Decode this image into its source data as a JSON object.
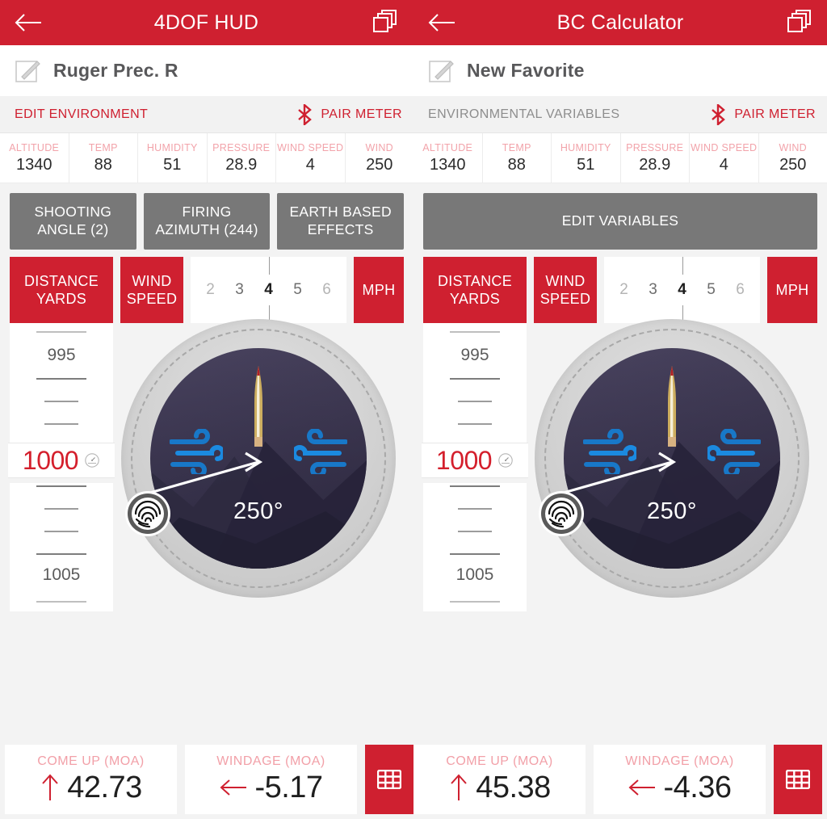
{
  "accent": {
    "red": "#cf2030",
    "gray_button": "#787878",
    "label_pink": "#f2a3aa"
  },
  "panels": [
    {
      "nav": {
        "title": "4DOF HUD",
        "back_icon": "arrow-left-icon",
        "copy_icon": "copy-windows-icon"
      },
      "profile": {
        "name": "Ruger Prec. R",
        "edit_icon": "pencil-square-icon"
      },
      "subbar": {
        "left_label": "EDIT ENVIRONMENT",
        "left_muted": false,
        "pair_label": "PAIR METER",
        "pair_icon": "bluetooth-icon"
      },
      "stats": [
        {
          "label": "ALTITUDE",
          "value": "1340"
        },
        {
          "label": "TEMP",
          "value": "88"
        },
        {
          "label": "HUMIDITY",
          "value": "51"
        },
        {
          "label": "PRESSURE",
          "value": "28.9"
        },
        {
          "label": "WIND SPEED",
          "value": "4"
        },
        {
          "label": "WIND",
          "value": "250"
        }
      ],
      "gray_buttons": [
        {
          "label": "SHOOTING ANGLE (2)"
        },
        {
          "label": "FIRING AZIMUTH (244)"
        },
        {
          "label": "EARTH BASED EFFECTS"
        }
      ],
      "selector": {
        "distance_label": "DISTANCE YARDS",
        "wind_label": "WIND SPEED",
        "unit_label": "MPH",
        "wind_options": [
          "2",
          "3",
          "4",
          "5",
          "6"
        ],
        "wind_selected": "4"
      },
      "distance_picker": {
        "above_label": "995",
        "selected": "1000",
        "below_label": "1005",
        "gauge_icon": "speedometer-icon"
      },
      "compass": {
        "degrees": "250°",
        "bullet_icon": "bullet-icon",
        "wind_icon": "wind-lines-icon",
        "handle_icon": "fingerprint-icon"
      },
      "results": [
        {
          "label": "COME UP (MOA)",
          "value": "42.73",
          "arrow": "arrow-up-icon"
        },
        {
          "label": "WINDAGE (MOA)",
          "value": "-5.17",
          "arrow": "arrow-left-icon"
        }
      ],
      "results_grid_icon": "table-grid-icon"
    },
    {
      "nav": {
        "title": "BC Calculator",
        "back_icon": "arrow-left-icon",
        "copy_icon": "copy-windows-icon"
      },
      "profile": {
        "name": "New Favorite",
        "edit_icon": "pencil-square-icon"
      },
      "subbar": {
        "left_label": "ENVIRONMENTAL VARIABLES",
        "left_muted": true,
        "pair_label": "PAIR METER",
        "pair_icon": "bluetooth-icon"
      },
      "stats": [
        {
          "label": "ALTITUDE",
          "value": "1340"
        },
        {
          "label": "TEMP",
          "value": "88"
        },
        {
          "label": "HUMIDITY",
          "value": "51"
        },
        {
          "label": "PRESSURE",
          "value": "28.9"
        },
        {
          "label": "WIND SPEED",
          "value": "4"
        },
        {
          "label": "WIND",
          "value": "250"
        }
      ],
      "gray_buttons": [
        {
          "label": "EDIT VARIABLES"
        }
      ],
      "selector": {
        "distance_label": "DISTANCE YARDS",
        "wind_label": "WIND SPEED",
        "unit_label": "MPH",
        "wind_options": [
          "2",
          "3",
          "4",
          "5",
          "6"
        ],
        "wind_selected": "4"
      },
      "distance_picker": {
        "above_label": "995",
        "selected": "1000",
        "below_label": "1005",
        "gauge_icon": "speedometer-icon"
      },
      "compass": {
        "degrees": "250°",
        "bullet_icon": "bullet-icon",
        "wind_icon": "wind-lines-icon",
        "handle_icon": "fingerprint-icon"
      },
      "results": [
        {
          "label": "COME UP (MOA)",
          "value": "45.38",
          "arrow": "arrow-up-icon"
        },
        {
          "label": "WINDAGE (MOA)",
          "value": "-4.36",
          "arrow": "arrow-left-icon"
        }
      ],
      "results_grid_icon": "table-grid-icon"
    }
  ]
}
